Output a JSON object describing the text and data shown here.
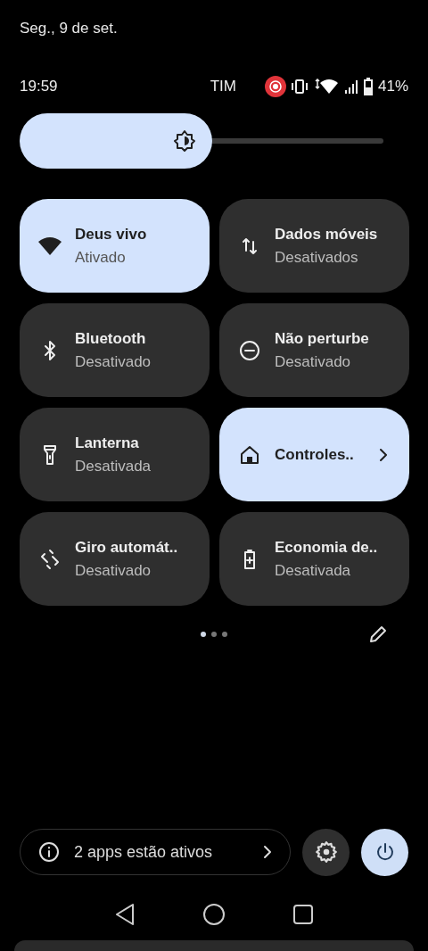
{
  "header": {
    "date": "Seg., 9 de set."
  },
  "status_bar": {
    "time": "19:59",
    "carrier": "TIM",
    "battery": "41%"
  },
  "brightness": {
    "level": 0.53
  },
  "tiles": [
    {
      "title": "Deus vivo",
      "subtitle": "Ativado",
      "on": true
    },
    {
      "title": "Dados móveis",
      "subtitle": "Desativados",
      "on": false
    },
    {
      "title": "Bluetooth",
      "subtitle": "Desativado",
      "on": false
    },
    {
      "title": "Não perturbe",
      "subtitle": "Desativado",
      "on": false
    },
    {
      "title": "Lanterna",
      "subtitle": "Desativada",
      "on": false
    },
    {
      "title": "Controles..",
      "on": true,
      "chevron": true
    },
    {
      "title": "Giro automát..",
      "subtitle": "Desativado",
      "on": false
    },
    {
      "title": "Economia de..",
      "subtitle": "Desativada",
      "on": false
    }
  ],
  "page_dots": [
    {
      "selected": true
    },
    {
      "selected": false
    },
    {
      "selected": false
    }
  ],
  "footer": {
    "active_apps": "2 apps estão ativos"
  }
}
